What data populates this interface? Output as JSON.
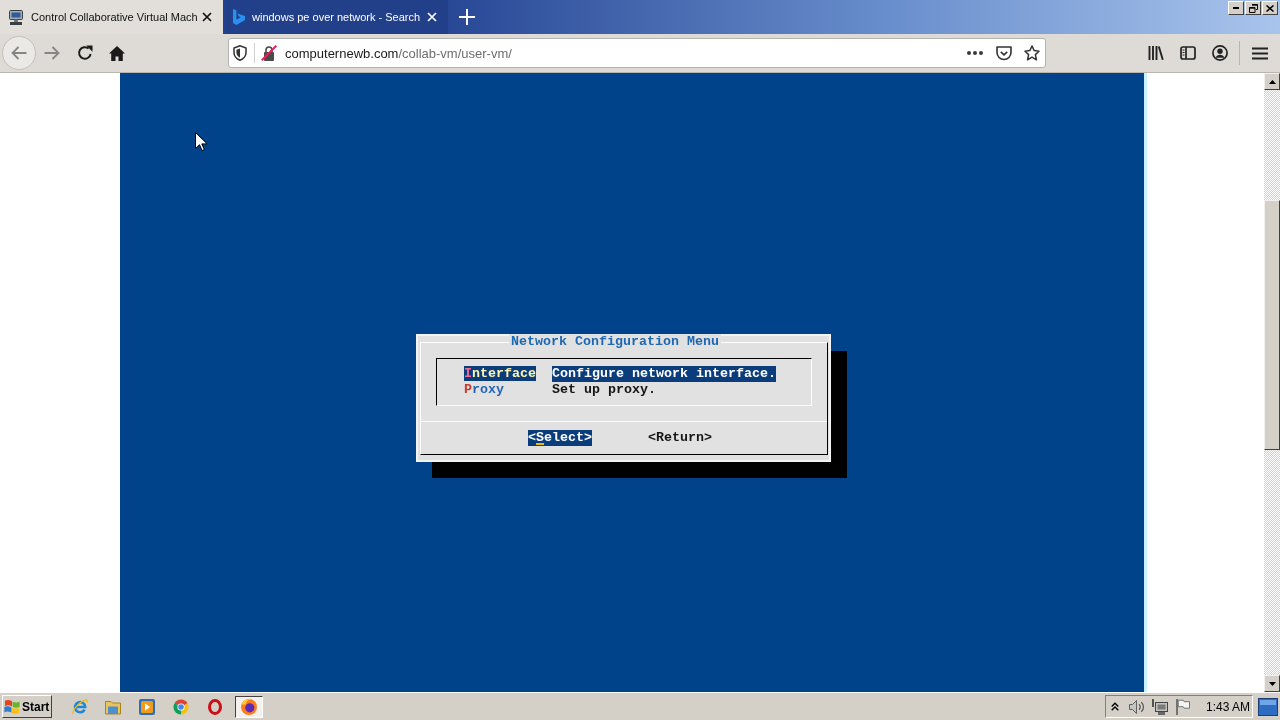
{
  "browser": {
    "tabs": [
      {
        "title": "Control Collaborative Virtual Mach",
        "selected": true
      },
      {
        "title": "windows pe over network - Search",
        "selected": false
      }
    ],
    "address_bar": {
      "domain": "computernewb.com",
      "path": "/collab-vm/user-vm/"
    }
  },
  "vm_screen": {
    "dialog": {
      "title": "Network Configuration Menu",
      "items": [
        {
          "label": "Interface",
          "description": "Configure network interface.",
          "selected": true
        },
        {
          "label": "Proxy",
          "description": "Set up proxy.",
          "selected": false
        }
      ],
      "buttons": [
        {
          "label": "<Select>",
          "selected": true
        },
        {
          "label": "<Return>",
          "selected": false
        }
      ]
    }
  },
  "taskbar": {
    "start_button": "Start",
    "clock": "1:43 AM"
  }
}
